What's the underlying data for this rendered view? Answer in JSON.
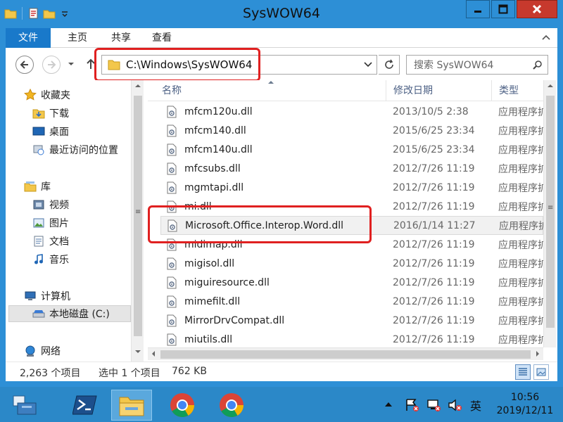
{
  "window": {
    "title": "SysWOW64"
  },
  "ribbon": {
    "tabs": [
      "文件",
      "主页",
      "共享",
      "查看"
    ]
  },
  "address": {
    "path": "C:\\Windows\\SysWOW64",
    "search_placeholder": "搜索 SysWOW64"
  },
  "sidebar": {
    "favorites": "收藏夹",
    "downloads": "下载",
    "desktop": "桌面",
    "recent": "最近访问的位置",
    "libraries": "库",
    "videos": "视频",
    "pictures": "图片",
    "documents": "文档",
    "music": "音乐",
    "computer": "计算机",
    "local_disk": "本地磁盘 (C:)",
    "network": "网络"
  },
  "columns": {
    "name": "名称",
    "date": "修改日期",
    "type": "类型"
  },
  "files": [
    {
      "name": "mfcm120u.dll",
      "date": "2013/10/5 2:38",
      "type": "应用程序扩展"
    },
    {
      "name": "mfcm140.dll",
      "date": "2015/6/25 23:34",
      "type": "应用程序扩展"
    },
    {
      "name": "mfcm140u.dll",
      "date": "2015/6/25 23:34",
      "type": "应用程序扩展"
    },
    {
      "name": "mfcsubs.dll",
      "date": "2012/7/26 11:19",
      "type": "应用程序扩展"
    },
    {
      "name": "mgmtapi.dll",
      "date": "2012/7/26 11:19",
      "type": "应用程序扩展"
    },
    {
      "name": "mi.dll",
      "date": "2012/7/26 11:19",
      "type": "应用程序扩展"
    },
    {
      "name": "Microsoft.Office.Interop.Word.dll",
      "date": "2016/1/14 11:27",
      "type": "应用程序扩展"
    },
    {
      "name": "midimap.dll",
      "date": "2012/7/26 11:19",
      "type": "应用程序扩展"
    },
    {
      "name": "migisol.dll",
      "date": "2012/7/26 11:19",
      "type": "应用程序扩展"
    },
    {
      "name": "miguiresource.dll",
      "date": "2012/7/26 11:19",
      "type": "应用程序扩展"
    },
    {
      "name": "mimefilt.dll",
      "date": "2012/7/26 11:19",
      "type": "应用程序扩展"
    },
    {
      "name": "MirrorDrvCompat.dll",
      "date": "2012/7/26 11:19",
      "type": "应用程序扩展"
    },
    {
      "name": "miutils.dll",
      "date": "2012/7/26 11:19",
      "type": "应用程序扩展"
    }
  ],
  "selected_index": 6,
  "status": {
    "count": "2,263 个项目",
    "selected": "选中 1 个项目",
    "size": "762 KB"
  },
  "taskbar": {
    "ime": "英",
    "time": "10:56",
    "date": "2019/12/11"
  },
  "colors": {
    "titlebar": "#2d8fd6",
    "file_tab": "#1979ca",
    "highlight_box": "#e02020",
    "close_button": "#c7392d",
    "taskbar": "#2b88c8"
  }
}
